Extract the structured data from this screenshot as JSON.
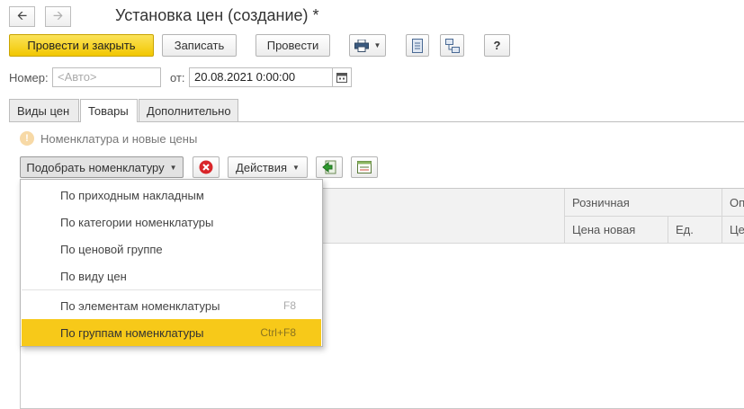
{
  "window": {
    "title": "Установка цен (создание) *"
  },
  "nav": {
    "back_icon": "arrow-left-icon",
    "forward_icon": "arrow-right-icon"
  },
  "toolbar": {
    "post_close": "Провести и закрыть",
    "save": "Записать",
    "post": "Провести",
    "help": "?"
  },
  "form": {
    "number_label": "Номер:",
    "number_placeholder": "<Авто>",
    "date_label": "от:",
    "date_value": "20.08.2021  0:00:00"
  },
  "tabs": [
    "Виды цен",
    "Товары",
    "Дополнительно"
  ],
  "hint_text": "Номенклатура и новые цены",
  "grid_toolbar": {
    "pick": "Подобрать номенклатуру",
    "actions": "Действия"
  },
  "table": {
    "group1": "Розничная",
    "group2": "Оп",
    "col_price_new": "Цена новая",
    "col_unit": "Ед.",
    "col_price2": "Це"
  },
  "menu": {
    "items": [
      {
        "label": "По приходным накладным",
        "shortcut": ""
      },
      {
        "label": "По категории номенклатуры",
        "shortcut": ""
      },
      {
        "label": "По ценовой группе",
        "shortcut": ""
      },
      {
        "label": "По виду цен",
        "shortcut": ""
      },
      {
        "label": "По элементам номенклатуры",
        "shortcut": "F8"
      },
      {
        "label": "По группам номенклатуры",
        "shortcut": "Ctrl+F8"
      }
    ]
  },
  "colors": {
    "accent_yellow": "#f7c919",
    "primary_button": "#f2c700"
  }
}
